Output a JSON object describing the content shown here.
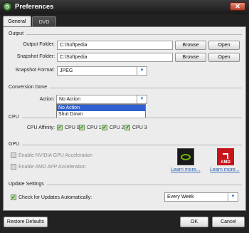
{
  "window": {
    "title": "Preferences",
    "close_symbol": "✕"
  },
  "tabs": [
    {
      "label": "General",
      "active": true
    },
    {
      "label": "DVD",
      "active": false
    }
  ],
  "output": {
    "section": "Output",
    "output_folder": {
      "label": "Output Folder:",
      "value": "C:\\Softpedia",
      "browse": "Browse",
      "open": "Open"
    },
    "snapshot_folder": {
      "label": "Snapshot Folder:",
      "value": "C:\\Softpedia",
      "browse": "Browse",
      "open": "Open"
    },
    "snapshot_format": {
      "label": "Snapshot Format:",
      "value": "JPEG"
    }
  },
  "conversion": {
    "section": "Conversion Done",
    "action_label": "Action:",
    "action_value": "No Action",
    "options": [
      "No Action",
      "Shut Down"
    ]
  },
  "cpu": {
    "section": "CPU",
    "affinity_label": "CPU Affinity:",
    "cores": [
      {
        "label": "CPU 0",
        "checked": true
      },
      {
        "label": "CPU 1",
        "checked": true
      },
      {
        "label": "CPU 2",
        "checked": true
      },
      {
        "label": "CPU 3",
        "checked": true
      }
    ]
  },
  "gpu": {
    "section": "GPU",
    "nvidia_label": "Enable NVIDIA GPU Acceleration",
    "amd_label": "Enable AMD APP Acceleration",
    "amd_logo_text": "AMD",
    "learn_more_nvidia": "Learn more...",
    "learn_more_amd": "Learn more..."
  },
  "update": {
    "section": "Update Settings",
    "check_label": "Check for Updates Automatically:",
    "check_checked": true,
    "frequency": "Every Week"
  },
  "footer": {
    "restore": "Restore Defaults",
    "ok": "OK",
    "cancel": "Cancel"
  },
  "colors": {
    "accent": "#2f5fd0",
    "link": "#2a5fb0",
    "titlebar": "#1a1a1a",
    "panel": "#ececec",
    "nvidia_green": "#76b900",
    "amd_red": "#c7141b"
  }
}
